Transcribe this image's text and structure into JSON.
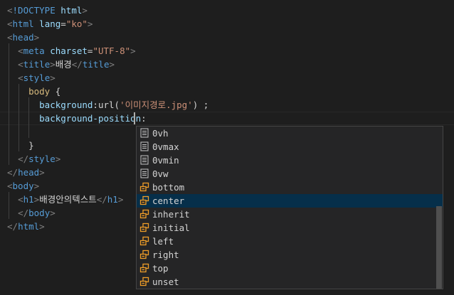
{
  "editor": {
    "lines": [
      {
        "parts": [
          [
            "ang",
            "<"
          ],
          [
            "tag",
            "!DOCTYPE"
          ],
          [
            "txt",
            " "
          ],
          [
            "attr",
            "html"
          ],
          [
            "ang",
            ">"
          ]
        ]
      },
      {
        "parts": [
          [
            "ang",
            "<"
          ],
          [
            "tag",
            "html"
          ],
          [
            "txt",
            " "
          ],
          [
            "attr",
            "lang"
          ],
          [
            "txt",
            "="
          ],
          [
            "str",
            "\"ko\""
          ],
          [
            "ang",
            ">"
          ]
        ]
      },
      {
        "parts": [
          [
            "ang",
            "<"
          ],
          [
            "tag",
            "head"
          ],
          [
            "ang",
            ">"
          ]
        ]
      },
      {
        "parts": [
          [
            "txt",
            "  "
          ],
          [
            "ang",
            "<"
          ],
          [
            "tag",
            "meta"
          ],
          [
            "txt",
            " "
          ],
          [
            "attr",
            "charset"
          ],
          [
            "txt",
            "="
          ],
          [
            "str",
            "\"UTF-8\""
          ],
          [
            "ang",
            ">"
          ]
        ]
      },
      {
        "parts": [
          [
            "txt",
            "  "
          ],
          [
            "ang",
            "<"
          ],
          [
            "tag",
            "title"
          ],
          [
            "ang",
            ">"
          ],
          [
            "txt",
            "배경"
          ],
          [
            "ang",
            "</"
          ],
          [
            "tag",
            "title"
          ],
          [
            "ang",
            ">"
          ]
        ]
      },
      {
        "parts": [
          [
            "txt",
            "  "
          ],
          [
            "ang",
            "<"
          ],
          [
            "tag",
            "style"
          ],
          [
            "ang",
            ">"
          ]
        ]
      },
      {
        "parts": [
          [
            "txt",
            "    "
          ],
          [
            "sel",
            "body"
          ],
          [
            "txt",
            " "
          ],
          [
            "punc",
            "{"
          ]
        ]
      },
      {
        "parts": [
          [
            "txt",
            "      "
          ],
          [
            "prop",
            "background"
          ],
          [
            "txt",
            ":"
          ],
          [
            "txt",
            "url("
          ],
          [
            "str",
            "'이미지경로.jpg'"
          ],
          [
            "txt",
            ") ;"
          ]
        ]
      },
      {
        "parts": [
          [
            "txt",
            "      "
          ],
          [
            "prop",
            "background-position"
          ],
          [
            "txt",
            ":"
          ]
        ]
      },
      {
        "parts": []
      },
      {
        "parts": [
          [
            "txt",
            "    "
          ],
          [
            "punc",
            "}"
          ]
        ]
      },
      {
        "parts": [
          [
            "txt",
            "  "
          ],
          [
            "ang",
            "</"
          ],
          [
            "tag",
            "style"
          ],
          [
            "ang",
            ">"
          ]
        ]
      },
      {
        "parts": [
          [
            "ang",
            "</"
          ],
          [
            "tag",
            "head"
          ],
          [
            "ang",
            ">"
          ]
        ]
      },
      {
        "parts": [
          [
            "ang",
            "<"
          ],
          [
            "tag",
            "body"
          ],
          [
            "ang",
            ">"
          ]
        ]
      },
      {
        "parts": [
          [
            "txt",
            "  "
          ],
          [
            "ang",
            "<"
          ],
          [
            "tag",
            "h1"
          ],
          [
            "ang",
            ">"
          ],
          [
            "txt",
            "배경안의텍스트"
          ],
          [
            "ang",
            "</"
          ],
          [
            "tag",
            "h1"
          ],
          [
            "ang",
            ">"
          ]
        ]
      },
      {
        "parts": [
          [
            "txt",
            "  "
          ],
          [
            "ang",
            "</"
          ],
          [
            "tag",
            "body"
          ],
          [
            "ang",
            ">"
          ]
        ]
      },
      {
        "parts": [
          [
            "ang",
            "</"
          ],
          [
            "tag",
            "html"
          ],
          [
            "ang",
            ">"
          ]
        ]
      }
    ]
  },
  "suggestions": {
    "items": [
      {
        "label": "0vh",
        "kind": "value",
        "icon": "value-icon"
      },
      {
        "label": "0vmax",
        "kind": "value",
        "icon": "value-icon"
      },
      {
        "label": "0vmin",
        "kind": "value",
        "icon": "value-icon"
      },
      {
        "label": "0vw",
        "kind": "value",
        "icon": "value-icon"
      },
      {
        "label": "bottom",
        "kind": "enum",
        "icon": "enum-icon"
      },
      {
        "label": "center",
        "kind": "enum",
        "icon": "enum-icon",
        "selected": true
      },
      {
        "label": "inherit",
        "kind": "enum",
        "icon": "enum-icon"
      },
      {
        "label": "initial",
        "kind": "enum",
        "icon": "enum-icon"
      },
      {
        "label": "left",
        "kind": "enum",
        "icon": "enum-icon"
      },
      {
        "label": "right",
        "kind": "enum",
        "icon": "enum-icon"
      },
      {
        "label": "top",
        "kind": "enum",
        "icon": "enum-icon"
      },
      {
        "label": "unset",
        "kind": "enum",
        "icon": "enum-icon"
      }
    ]
  },
  "colors": {
    "background": "#1e1e1e",
    "selected_item": "#062f4a",
    "enum_icon": "#ee9d28",
    "value_icon": "#c5c5c5"
  }
}
